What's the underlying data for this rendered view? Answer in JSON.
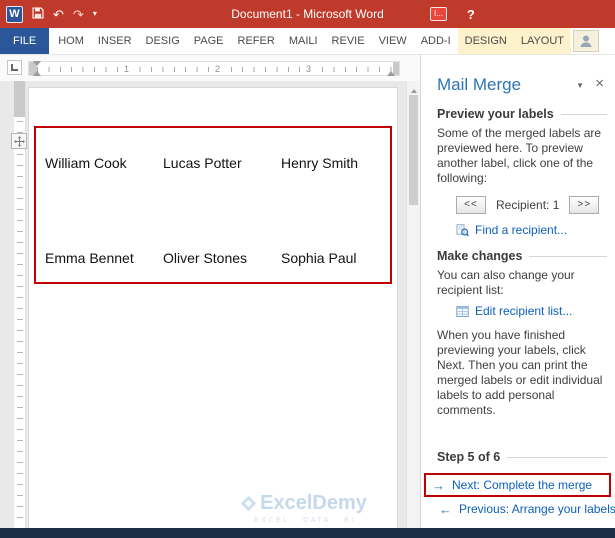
{
  "colors": {
    "titlebar_red": "#c03a2b",
    "file_tab_blue": "#2b579a",
    "contextual_tab_yellow": "#fdf2cb",
    "pane_title_blue": "#2e75b6",
    "link_blue": "#0d5fbb",
    "annotation_red": "#c00000",
    "watermark_blue": "#c6d9ec"
  },
  "titlebar": {
    "title": "Document1 -  Microsoft Word",
    "badge_label": "I...",
    "help_label": "?",
    "qat": {
      "word_glyph": "W",
      "undo_glyph": "↶",
      "redo_glyph": "↷",
      "dropdown_glyph": "▾"
    }
  },
  "ribbon": {
    "tabs": [
      {
        "label": "FILE"
      },
      {
        "label": "HOM"
      },
      {
        "label": "INSER"
      },
      {
        "label": "DESIG"
      },
      {
        "label": "PAGE"
      },
      {
        "label": "REFER"
      },
      {
        "label": "MAILI"
      },
      {
        "label": "REVIE"
      },
      {
        "label": "VIEW"
      },
      {
        "label": "ADD-I"
      },
      {
        "label": "DESIGN"
      },
      {
        "label": "LAYOUT"
      }
    ]
  },
  "ruler": {
    "marks": [
      "1",
      "2",
      "3"
    ]
  },
  "document": {
    "labels": [
      [
        "William Cook",
        "Lucas Potter",
        "Henry Smith"
      ],
      [
        "Emma Bennet",
        "Oliver Stones",
        "Sophia Paul"
      ]
    ],
    "watermark": {
      "brand": "ExcelDemy",
      "tagline": "EXCEL · DATA · BI"
    }
  },
  "taskpane": {
    "title": "Mail Merge",
    "pane_icons": {
      "options": "▼",
      "close": "×"
    },
    "preview": {
      "heading": "Preview your labels",
      "description": "Some of the merged labels are previewed here. To preview another label, click one of the following:",
      "prev_button": "<<",
      "next_button": ">>",
      "recipient_label": "Recipient: 1",
      "find_link": "Find a recipient..."
    },
    "changes": {
      "heading": "Make changes",
      "description": "You can also change your recipient list:",
      "edit_link": "Edit recipient list...",
      "note": "When you have finished previewing your labels, click Next. Then you can print the merged labels or edit individual labels to add personal comments."
    },
    "wizard": {
      "step_label": "Step 5 of 6",
      "next_arrow": "→",
      "next_link": "Next: Complete the merge",
      "prev_arrow": "←",
      "prev_link": "Previous: Arrange your labels"
    }
  }
}
